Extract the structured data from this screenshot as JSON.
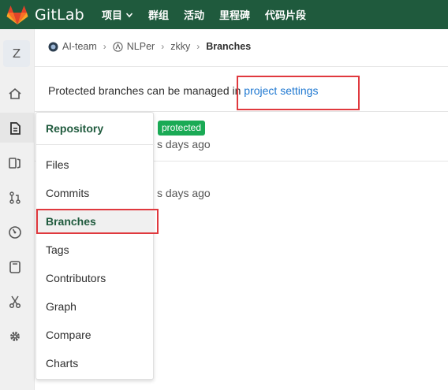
{
  "navbar": {
    "brand": "GitLab",
    "items": [
      "项目",
      "群组",
      "活动",
      "里程碑",
      "代码片段"
    ],
    "logo_icon": "gitlab-fox-icon",
    "background": "#1f5a3d"
  },
  "sidebar": {
    "avatar_letter": "Z",
    "icons": [
      "home-icon",
      "repository-doc-icon",
      "issues-icon",
      "merge-request-icon",
      "ci-gauge-icon",
      "wiki-book-icon",
      "snippets-scissors-icon",
      "settings-gear-icon"
    ],
    "active_icon": "repository-doc-icon"
  },
  "breadcrumb": {
    "items": [
      "AI-team",
      "NLPer",
      "zkky"
    ],
    "current": "Branches"
  },
  "info": {
    "text": "Protected branches can be managed in ",
    "link": "project settings"
  },
  "branches": {
    "badge": "protected",
    "row1_age": "s days ago",
    "row2_age": "s days ago"
  },
  "flyout": {
    "title": "Repository",
    "items": [
      "Files",
      "Commits",
      "Branches",
      "Tags",
      "Contributors",
      "Graph",
      "Compare",
      "Charts"
    ],
    "active": "Branches"
  },
  "colors": {
    "accent_green": "#1f5a3d",
    "link_blue": "#1f78d1",
    "badge_green": "#1aaa55",
    "highlight_red": "#e0393e"
  }
}
